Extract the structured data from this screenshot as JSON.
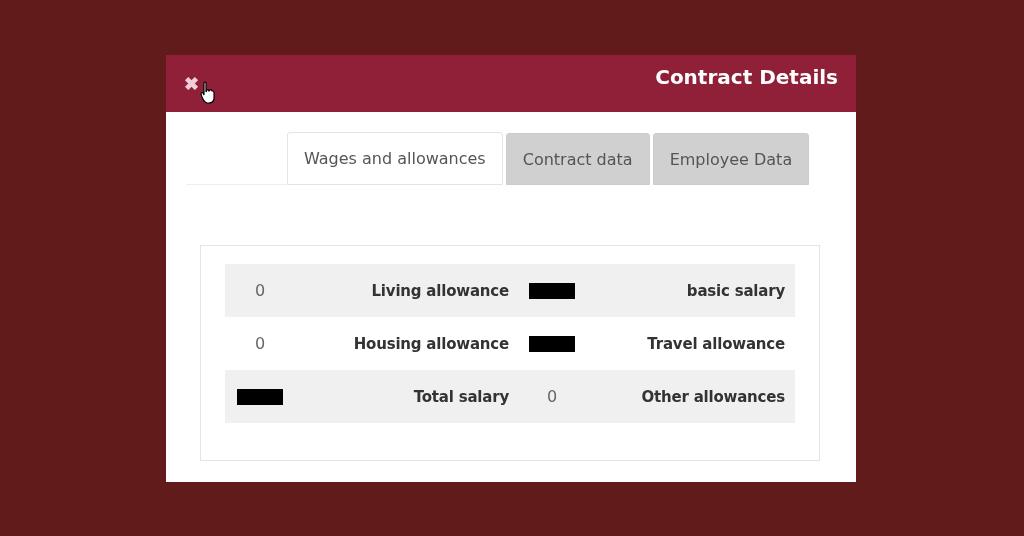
{
  "dialog": {
    "title": "Contract Details",
    "close": "✖"
  },
  "tabs": [
    {
      "label": "Wages and allowances",
      "selected": true
    },
    {
      "label": "Contract data",
      "selected": false
    },
    {
      "label": "Employee Data",
      "selected": false
    }
  ],
  "rows": [
    {
      "cells": [
        {
          "kind": "value",
          "text": "0"
        },
        {
          "kind": "label",
          "text": "Living allowance"
        },
        {
          "kind": "redacted"
        },
        {
          "kind": "label",
          "text": "basic salary"
        }
      ]
    },
    {
      "cells": [
        {
          "kind": "value",
          "text": "0"
        },
        {
          "kind": "label",
          "text": "Housing allowance"
        },
        {
          "kind": "redacted"
        },
        {
          "kind": "label",
          "text": "Travel allowance"
        }
      ]
    },
    {
      "cells": [
        {
          "kind": "redacted"
        },
        {
          "kind": "label",
          "text": "Total salary"
        },
        {
          "kind": "value",
          "text": "0"
        },
        {
          "kind": "label",
          "text": "Other allowances"
        }
      ]
    }
  ]
}
